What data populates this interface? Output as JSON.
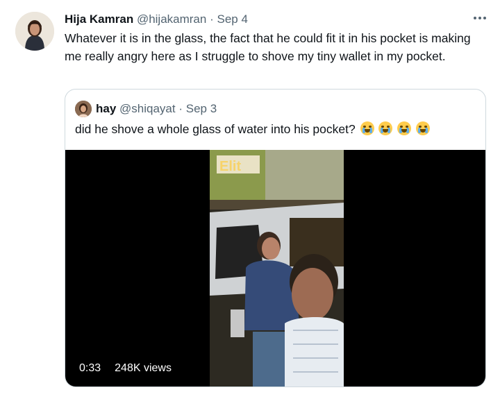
{
  "tweet": {
    "author_name": "Hija Kamran",
    "author_handle": "@hijakamran",
    "separator": "·",
    "date": "Sep 4",
    "more_icon": "more-horizontal-icon",
    "text": "Whatever it is in the glass, the fact that he could fit it in his pocket is making me really angry here as I struggle to shove my tiny wallet in my pocket."
  },
  "quote": {
    "author_name": "hay",
    "author_handle": "@shiqayat",
    "separator": "·",
    "date": "Sep 3",
    "text": "did he shove a whole glass of water into his pocket?",
    "emojis": [
      "loudly-crying-face",
      "loudly-crying-face",
      "face-with-tears-of-joy",
      "face-with-tears-of-joy"
    ],
    "video": {
      "duration": "0:33",
      "views": "248K views",
      "sign_text": "Elit"
    }
  },
  "colors": {
    "text": "#0f1419",
    "muted": "#536471",
    "border": "#cfd9de",
    "video_bg": "#000000"
  }
}
